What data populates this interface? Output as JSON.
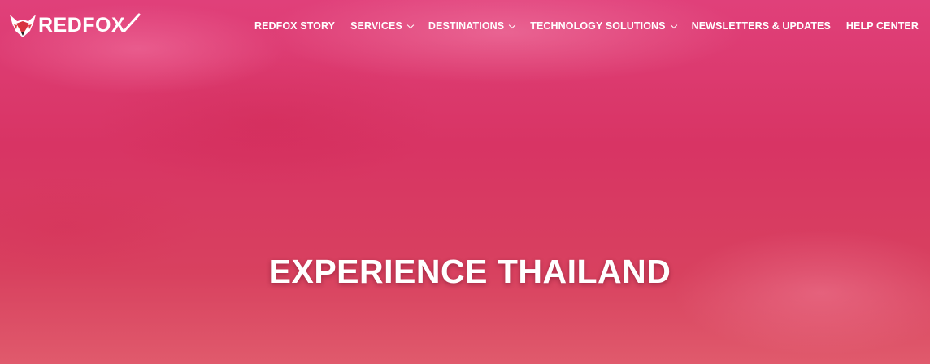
{
  "brand": {
    "name": "REDFOX",
    "logo_icon": "fox-head-icon",
    "colors": {
      "hero_top": "#e0407a",
      "hero_mid": "#d83464",
      "hero_bottom": "#e05a6c",
      "text": "#ffffff"
    }
  },
  "nav": {
    "items": [
      {
        "label": "REDFOX STORY",
        "has_dropdown": false
      },
      {
        "label": "SERVICES",
        "has_dropdown": true
      },
      {
        "label": "DESTINATIONS",
        "has_dropdown": true
      },
      {
        "label": "TECHNOLOGY SOLUTIONS",
        "has_dropdown": true
      },
      {
        "label": "NEWSLETTERS & UPDATES",
        "has_dropdown": false
      },
      {
        "label": "HELP CENTER",
        "has_dropdown": false
      }
    ]
  },
  "hero": {
    "title": "EXPERIENCE THAILAND"
  }
}
